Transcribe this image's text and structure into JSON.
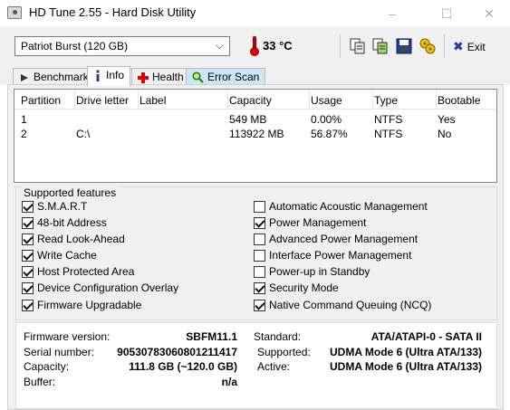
{
  "window": {
    "title": "HD Tune 2.55 - Hard Disk Utility",
    "minimize": "–",
    "maximize": "☐",
    "close": "✕"
  },
  "toolbar": {
    "drive": "Patriot Burst (120 GB)",
    "temperature": "33 °C",
    "exit_label": "Exit",
    "icons": [
      "copy-icon",
      "copy-all-icon",
      "save-icon",
      "options-icon"
    ]
  },
  "tabs": [
    {
      "label": "Benchmark",
      "icon": "benchmark-icon"
    },
    {
      "label": "Info",
      "icon": "info-icon",
      "active": true
    },
    {
      "label": "Health",
      "icon": "health-icon"
    },
    {
      "label": "Error Scan",
      "icon": "error-scan-icon"
    }
  ],
  "partitions": {
    "columns": [
      "Partition",
      "Drive letter",
      "Label",
      "Capacity",
      "Usage",
      "Type",
      "Bootable"
    ],
    "rows": [
      [
        "1",
        "",
        "",
        "549 MB",
        "0.00%",
        "NTFS",
        "Yes"
      ],
      [
        "2",
        "C:\\",
        "",
        "113922 MB",
        "56.87%",
        "NTFS",
        "No"
      ]
    ]
  },
  "features": {
    "title": "Supported features",
    "left": [
      {
        "label": "S.M.A.R.T",
        "checked": true
      },
      {
        "label": "48-bit Address",
        "checked": true
      },
      {
        "label": "Read Look-Ahead",
        "checked": true
      },
      {
        "label": "Write Cache",
        "checked": true
      },
      {
        "label": "Host Protected Area",
        "checked": true
      },
      {
        "label": "Device Configuration Overlay",
        "checked": true
      },
      {
        "label": "Firmware Upgradable",
        "checked": true
      }
    ],
    "right": [
      {
        "label": "Automatic Acoustic Management",
        "checked": false
      },
      {
        "label": "Power Management",
        "checked": true
      },
      {
        "label": "Advanced Power Management",
        "checked": false
      },
      {
        "label": "Interface Power Management",
        "checked": false
      },
      {
        "label": "Power-up in Standby",
        "checked": false
      },
      {
        "label": "Security Mode",
        "checked": true
      },
      {
        "label": "Native Command Queuing (NCQ)",
        "checked": true
      }
    ]
  },
  "info": {
    "firmware_label": "Firmware version:",
    "firmware": "SBFM11.1",
    "serial_label": "Serial number:",
    "serial": "90530783060801211417",
    "capacity_label": "Capacity:",
    "capacity": "111.8 GB (~120.0 GB)",
    "buffer_label": "Buffer:",
    "buffer": "n/a",
    "standard_label": "Standard:",
    "standard": "ATA/ATAPI-0 - SATA II",
    "supported_label": "Supported:",
    "supported": "UDMA Mode 6 (Ultra ATA/133)",
    "active_label": "Active:",
    "active": "UDMA Mode 6 (Ultra ATA/133)"
  },
  "colors": {
    "tab_highlight": "#cbe8f6",
    "thermometer": "#d00000",
    "exit_x": "#1f3f9f"
  }
}
